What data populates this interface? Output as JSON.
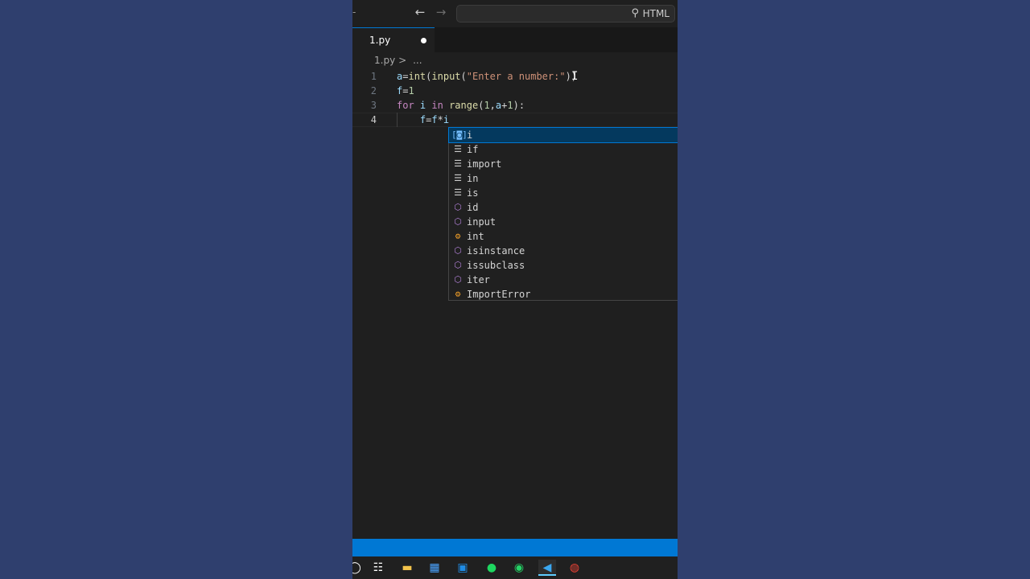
{
  "titlebar": {
    "search_label": "HTML"
  },
  "tabs": [
    {
      "label": "1.py",
      "dirty": true
    }
  ],
  "breadcrumb": {
    "file": "1.py",
    "separator": ">",
    "more": "..."
  },
  "editor": {
    "line_numbers": [
      "1",
      "2",
      "3",
      "4"
    ],
    "active_line": "4"
  },
  "suggestions": [
    {
      "icon": "variable-icon",
      "label": "i",
      "selected": true
    },
    {
      "icon": "keyword-icon",
      "label": "if"
    },
    {
      "icon": "keyword-icon",
      "label": "import"
    },
    {
      "icon": "keyword-icon",
      "label": "in"
    },
    {
      "icon": "keyword-icon",
      "label": "is"
    },
    {
      "icon": "function-icon",
      "label": "id"
    },
    {
      "icon": "function-icon",
      "label": "input"
    },
    {
      "icon": "class-icon",
      "label": "int"
    },
    {
      "icon": "function-icon",
      "label": "isinstance"
    },
    {
      "icon": "function-icon",
      "label": "issubclass"
    },
    {
      "icon": "function-icon",
      "label": "iter"
    },
    {
      "icon": "class-icon",
      "label": "ImportError"
    }
  ],
  "colors": {
    "accent": "#0078d4",
    "status_bar": "#0078d4",
    "desktop_bg": "#2f3f6e"
  },
  "taskbar_icons": [
    "search-icon",
    "task-view-icon",
    "file-explorer-icon",
    "store-icon",
    "outlook-icon",
    "spotify-icon",
    "whatsapp-icon",
    "vscode-icon",
    "chrome-icon"
  ]
}
